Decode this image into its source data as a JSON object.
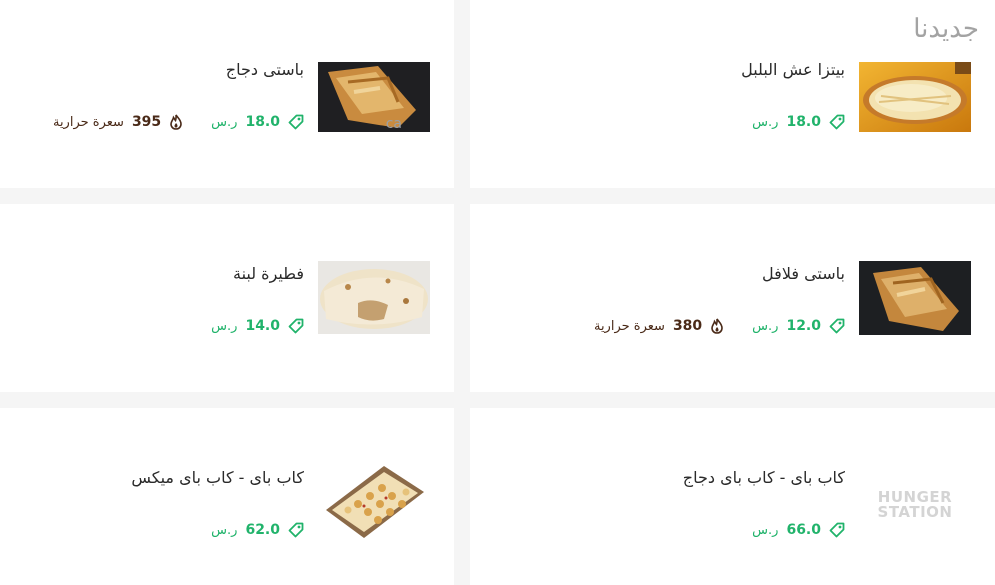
{
  "section": {
    "title": "جديدنا"
  },
  "items": [
    {
      "name": "بيتزا عش البلبل",
      "price": "18.0",
      "currency": "ر.س",
      "calories": "",
      "calories_unit": "",
      "image": "pizza-image"
    },
    {
      "name": "باستى دجاج",
      "price": "18.0",
      "currency": "ر.س",
      "calories": "395",
      "calories_unit": "سعرة حرارية",
      "image": "chicken-pastry-image"
    },
    {
      "name": "باستى فلافل",
      "price": "12.0",
      "currency": "ر.س",
      "calories": "380",
      "calories_unit": "سعرة حرارية",
      "image": "falafel-pastry-image"
    },
    {
      "name": "فطيرة لبنة",
      "price": "14.0",
      "currency": "ر.س",
      "calories": "",
      "calories_unit": "",
      "image": "labneh-pie-image"
    },
    {
      "name": "كاب باى - كاب باى دجاج",
      "price": "66.0",
      "currency": "ر.س",
      "calories": "",
      "calories_unit": "",
      "image": "hunger-station-placeholder"
    },
    {
      "name": "كاب باى - كاب باى ميكس",
      "price": "62.0",
      "currency": "ر.س",
      "calories": "",
      "calories_unit": "",
      "image": "mix-box-image"
    }
  ],
  "placeholder_logo": {
    "line1": "HUNGER",
    "line2": "STATION"
  },
  "colors": {
    "price": "#21b36b",
    "calories": "#4a2a18",
    "title": "#a3a3a3",
    "background": "#f5f5f5",
    "card": "#ffffff"
  }
}
